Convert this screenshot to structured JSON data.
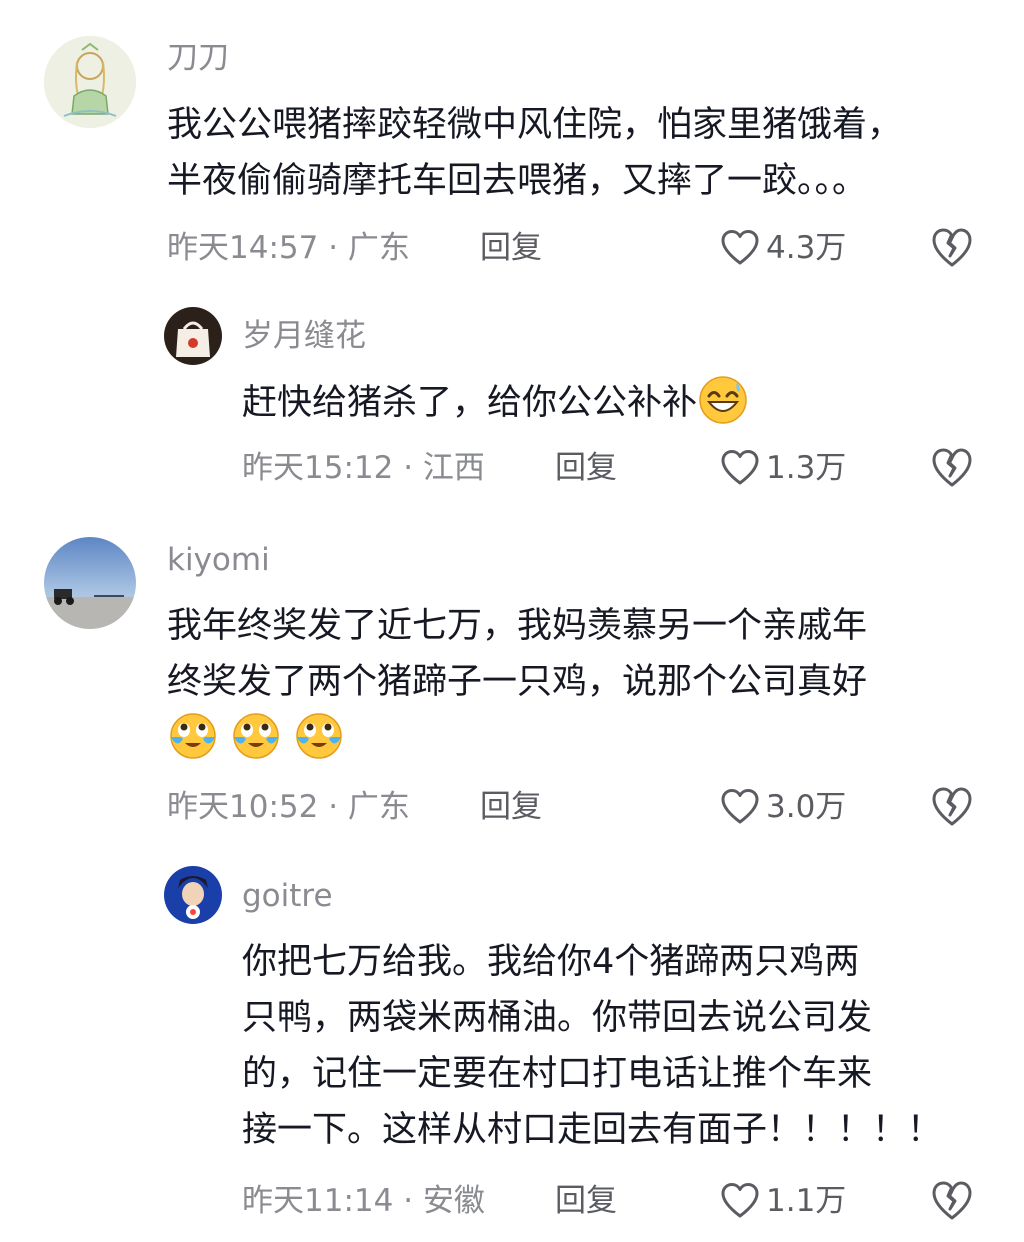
{
  "comments": [
    {
      "username": "刀刀",
      "lines": [
        "我公公喂猪摔跤轻微中风住院，怕家里猪饿着，",
        "半夜偷偷骑摩托车回去喂猪，又摔了一跤。。。"
      ],
      "time": "昨天14:57 · 广东",
      "reply_label": "回复",
      "likes": "4.3万",
      "avatar_icon": "avatar-drawing-icon"
    },
    {
      "username": "岁月缝花",
      "lines": [
        "赶快给猪杀了，给你公公补补"
      ],
      "time": "昨天15:12 · 江西",
      "reply_label": "回复",
      "likes": "1.3万",
      "avatar_icon": "avatar-bag-icon"
    },
    {
      "username": "kiyomi",
      "lines": [
        "我年终奖发了近七万，我妈羡慕另一个亲戚年",
        "终奖发了两个猪蹄子一只鸡，说那个公司真好"
      ],
      "time": "昨天10:52 · 广东",
      "reply_label": "回复",
      "likes": "3.0万",
      "avatar_icon": "avatar-beach-icon"
    },
    {
      "username": "goitre",
      "lines": [
        "你把七万给我。我给你4个猪蹄两只鸡两",
        "只鸭，两袋米两桶油。你带回去说公司发",
        "的，记住一定要在村口打电话让推个车来",
        "接一下。这样从村口走回去有面子！！！！！"
      ],
      "time": "昨天11:14 · 安徽",
      "reply_label": "回复",
      "likes": "1.1万",
      "avatar_icon": "avatar-anime-icon"
    }
  ],
  "icons": {
    "like": "heart-outline-icon",
    "dislike": "broken-heart-icon",
    "grin": "grinning-sweat-emoji",
    "cry": "crying-laughing-emoji"
  },
  "colors": {
    "text": "#161823",
    "secondary": "#8a8b91",
    "action": "#5b5c61"
  }
}
